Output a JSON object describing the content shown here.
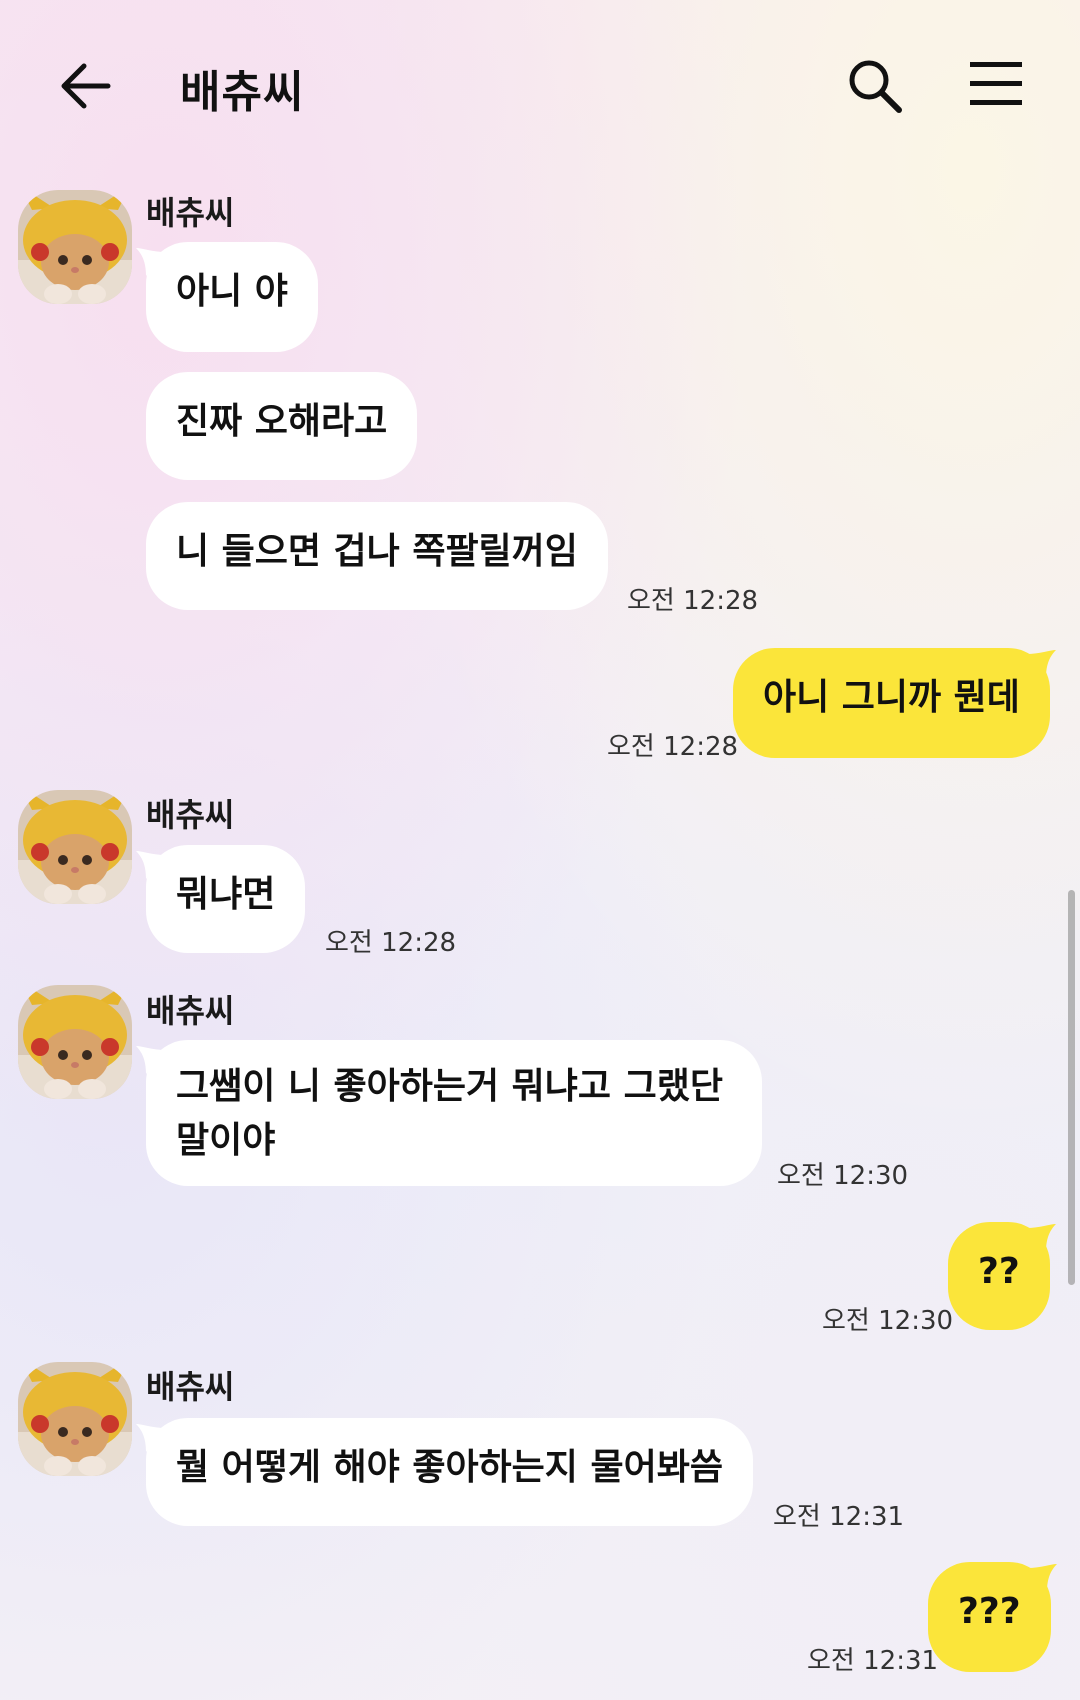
{
  "header": {
    "title": "배츄씨"
  },
  "icons": {
    "back": "arrow-left-icon",
    "search": "search-icon",
    "menu": "hamburger-menu-icon"
  },
  "colors": {
    "outgoing_bubble": "#fbe53a",
    "incoming_bubble": "#ffffff"
  },
  "messages": [
    {
      "sender": "배츄씨",
      "direction": "in",
      "text": "아니 야"
    },
    {
      "direction": "in",
      "text": "진짜 오해라고"
    },
    {
      "direction": "in",
      "text": "니 들으면 겁나 쪽팔릴꺼임",
      "time": "오전 12:28"
    },
    {
      "direction": "out",
      "text": "아니 그니까 뭔데",
      "time": "오전 12:28"
    },
    {
      "sender": "배츄씨",
      "direction": "in",
      "text": "뭐냐면",
      "time": "오전 12:28"
    },
    {
      "sender": "배츄씨",
      "direction": "in",
      "text_line1": "그쌤이 니 좋아하는거 뭐냐고 그랬단",
      "text_line2": "말이야",
      "time": "오전 12:30"
    },
    {
      "direction": "out",
      "text": "??",
      "time": "오전 12:30"
    },
    {
      "sender": "배츄씨",
      "direction": "in",
      "text": "뭘 어떻게 해야 좋아하는지 물어봐씀",
      "time": "오전 12:31"
    },
    {
      "direction": "out",
      "text": "???",
      "time": "오전 12:31"
    }
  ]
}
